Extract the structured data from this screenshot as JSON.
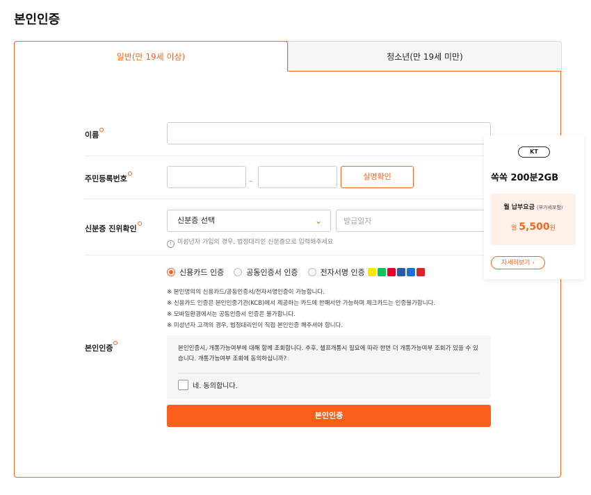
{
  "page": {
    "title": "본인인증"
  },
  "tabs": [
    {
      "label": "일반(만 19세 이상)",
      "active": true
    },
    {
      "label": "청소년(만 19세 미만)",
      "active": false
    }
  ],
  "form": {
    "name_label": "이름",
    "rrn_label": "주민등록번호",
    "rrn_separator": "–",
    "verify_button": "실명확인",
    "id_label": "신분증 진위확인",
    "id_select_value": "신분증 선택",
    "issue_date_placeholder": "발급일자",
    "id_hint": "미성년자 가입의 경우, 법정대리인 신분증으로 입력해주세요",
    "auth_label": "본인인증",
    "auth_methods": [
      {
        "label": "신용카드 인증",
        "selected": true
      },
      {
        "label": "공동인증서 인증",
        "selected": false
      },
      {
        "label": "전자서명 인증",
        "selected": false
      }
    ],
    "notes": [
      "※ 본인명의의 신용카드/공동인증서/전자서명인증이 가능합니다.",
      "※ 신용카드 인증은 본인인증기관(KCB)에서 제공하는 카드에 한해서만 가능하며 체크카드는 인증불가합니다.",
      "※ 모바일환경에서는 공동인증서 인증은 불가합니다.",
      "※ 미성년자 고객의 경우, 법정대리인이 직접 본인인증 해주셔야 합니다."
    ],
    "consent_text": "본인인증시, 개통가능여부에 대해 함께 조회합니다. 추후, 셀프개통시 필요에 따라 한번 더 개통가능여부 조회가 있을 수 있습니다. 개통가능여부 조회에 동의하십니까?",
    "consent_check": "네. 동의합니다.",
    "submit_button": "본인인증"
  },
  "side_card": {
    "carrier": "KT",
    "plan_name": "쏙쏙 200분2GB",
    "fee_label": "월 납부요금",
    "fee_note": "(부가세포함)",
    "fee_prefix": "월",
    "fee_amount": "5,500",
    "fee_unit": "원",
    "more_button": "자세히보기"
  },
  "colors": {
    "accent": "#f26522",
    "button": "#fa5f1e"
  },
  "icons": {
    "select": "chevron-down-icon",
    "hint": "info-icon",
    "more": "chevron-right-icon"
  }
}
